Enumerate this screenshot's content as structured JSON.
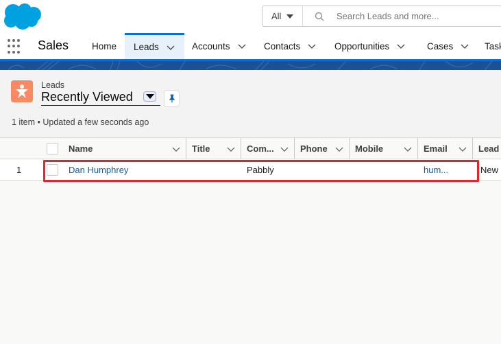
{
  "header": {
    "logo": "salesforce-cloud-logo",
    "search": {
      "scope": "All",
      "placeholder": "Search Leads and more..."
    }
  },
  "nav": {
    "app_name": "Sales",
    "tabs": [
      {
        "label": "Home",
        "dropdown": false
      },
      {
        "label": "Leads",
        "dropdown": true,
        "active": true
      },
      {
        "label": "Accounts",
        "dropdown": true
      },
      {
        "label": "Contacts",
        "dropdown": true
      },
      {
        "label": "Opportunities",
        "dropdown": true
      },
      {
        "label": "Cases",
        "dropdown": true
      },
      {
        "label": "Tasks",
        "dropdown": false
      }
    ]
  },
  "list_view": {
    "object_label": "Leads",
    "title": "Recently Viewed",
    "meta": "1 item • Updated a few seconds ago"
  },
  "table": {
    "columns": [
      "Name",
      "Title",
      "Com...",
      "Phone",
      "Mobile",
      "Email",
      "Lead"
    ],
    "rows": [
      {
        "index": "1",
        "name": "Dan Humphrey",
        "title": "",
        "company": "Pabbly",
        "phone": "",
        "mobile": "",
        "email": "hum...",
        "lead_status": "New"
      }
    ]
  },
  "colors": {
    "brand_blue": "#00a1e0",
    "nav_active": "#0b70d4",
    "lead_icon": "#f88962",
    "link": "#0b5cab",
    "highlight": "#e0262f"
  }
}
